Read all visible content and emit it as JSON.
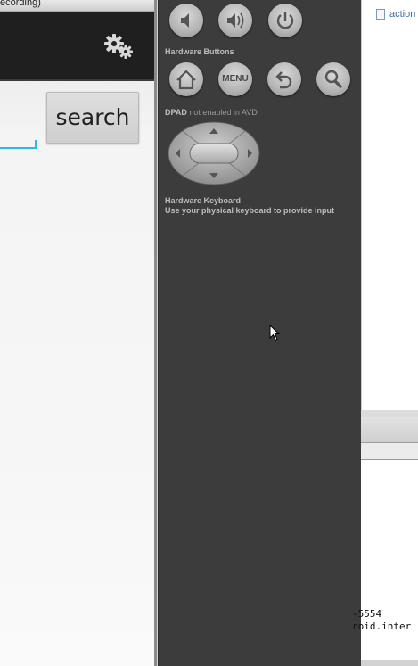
{
  "app_window": {
    "title": "ecording)",
    "search_button_label": "search"
  },
  "emulator_panel": {
    "hardware_buttons_label": "Hardware Buttons",
    "menu_button_label": "MENU",
    "dpad_label": "DPAD",
    "dpad_note": "not enabled in AVD",
    "keyboard_label": "Hardware Keyboard",
    "keyboard_note": "Use your physical keyboard to provide input",
    "icons": [
      "volume-down-icon",
      "volume-up-icon",
      "power-icon",
      "home-icon",
      "back-icon",
      "search-icon"
    ]
  },
  "ide": {
    "editor_tab_label": "action",
    "console_lines": [
      "-5554",
      "roid.inter"
    ]
  },
  "colors": {
    "action_bar": "#1f1f1f",
    "panel_bg": "#3c3c3c",
    "edit_text_underline": "#33b5e5",
    "button_bg": "#d6d6d6",
    "console_bg": "#ffffff"
  }
}
